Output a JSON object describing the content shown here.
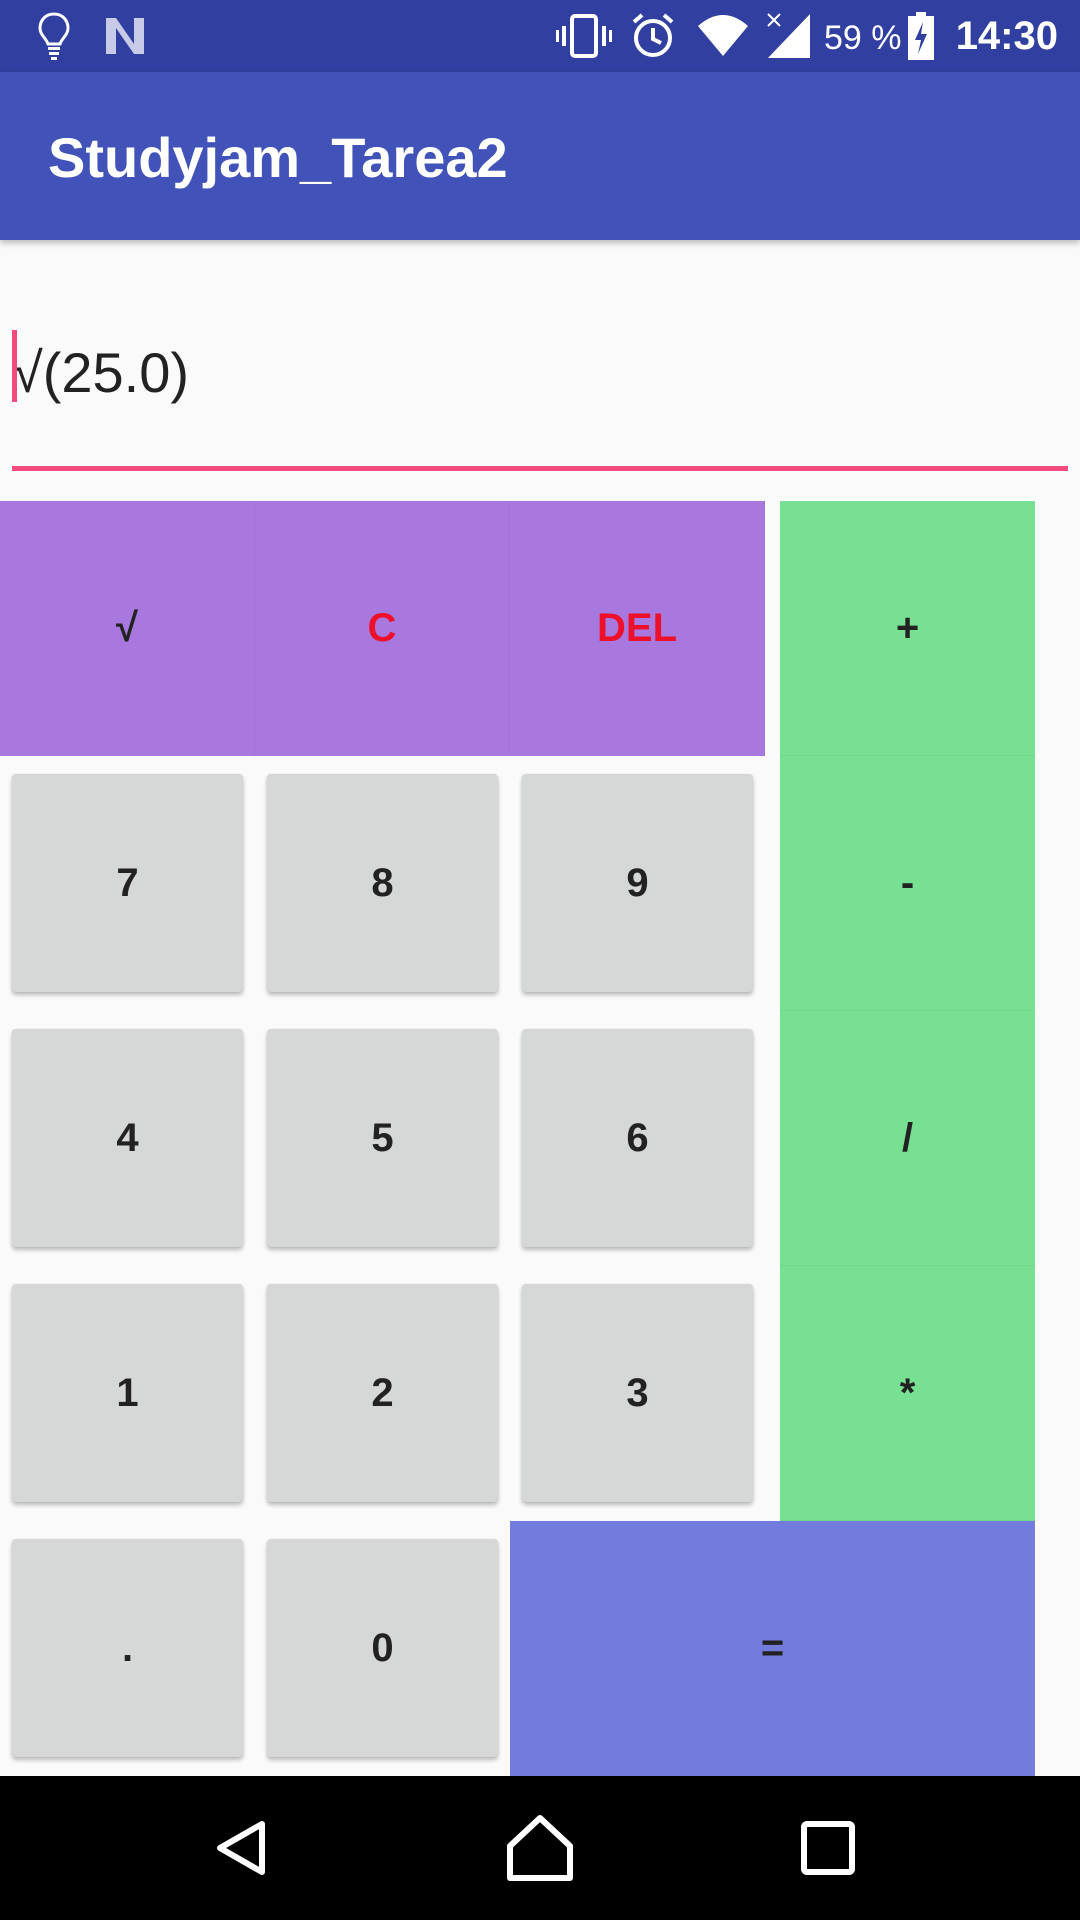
{
  "status_bar": {
    "battery_percent": "59 %",
    "time": "14:30",
    "icons": [
      "lightbulb-icon",
      "n-logo-icon",
      "vibrate-icon",
      "alarm-icon",
      "wifi-icon",
      "signal-icon",
      "battery-icon"
    ]
  },
  "app_bar": {
    "title": "Studyjam_Tarea2"
  },
  "display": {
    "value": "√(25.0)"
  },
  "keypad": {
    "sqrt": "√",
    "clear": "C",
    "del": "DEL",
    "plus": "+",
    "minus": "-",
    "divide": "/",
    "multiply": "*",
    "equals": "=",
    "seven": "7",
    "eight": "8",
    "nine": "9",
    "four": "4",
    "five": "5",
    "six": "6",
    "one": "1",
    "two": "2",
    "three": "3",
    "dot": ".",
    "zero": "0"
  },
  "colors": {
    "status_bar": "#3140a0",
    "app_bar": "#4153b8",
    "accent": "#f24a7d",
    "function_keys": "#a878de",
    "operator_keys": "#77e093",
    "equals_key": "#737cdc",
    "digit_keys": "#d6d7d7",
    "red_text": "#ee0f2a"
  },
  "nav_bar": {
    "icons": [
      "back-icon",
      "home-icon",
      "recents-icon"
    ]
  }
}
